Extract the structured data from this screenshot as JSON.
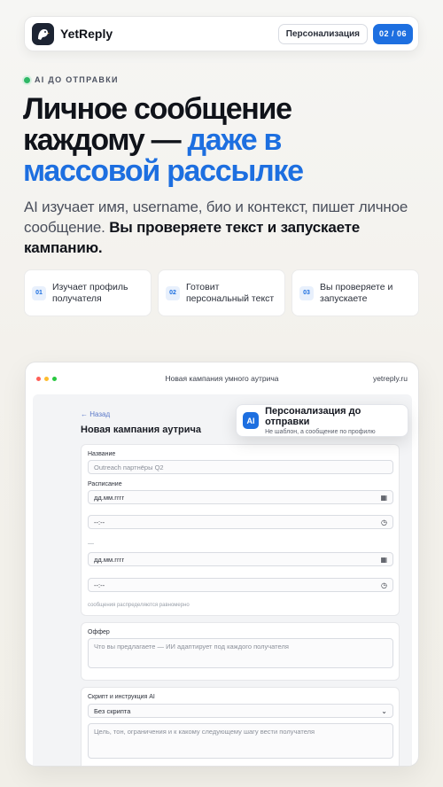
{
  "brand": {
    "name": "YetReply"
  },
  "header": {
    "personalization_button": "Персонализация",
    "page_indicator": "02 / 06"
  },
  "kicker": "AI ДО ОТПРАВКИ",
  "headline": {
    "line1": "Личное сообщение",
    "line2_dark": "каждому — ",
    "line2_accent": "даже в",
    "line3_accent": "массовой рассылке"
  },
  "lead": {
    "plain": "AI изучает имя, username, био и контекст, пишет личное сообщение. ",
    "bold": "Вы проверяете текст и запускаете кампанию."
  },
  "steps": [
    {
      "num": "01",
      "text": "Изучает профиль получателя"
    },
    {
      "num": "02",
      "text": "Готовит персональный текст"
    },
    {
      "num": "03",
      "text": "Вы проверяете и запускаете"
    }
  ],
  "window": {
    "title": "Новая кампания умного аутрича",
    "url": "yetreply.ru",
    "colors": {
      "red": "#ff5f57",
      "yellow": "#febc2e",
      "green": "#28c840"
    }
  },
  "form": {
    "back": "← Назад",
    "title": "Новая кампания аутрича",
    "name_label": "Название",
    "name_placeholder": "Outreach партнёры Q2",
    "schedule_label": "Расписание",
    "date1": "дд.мм.гггг",
    "time1": "--:--",
    "separator": "—",
    "date2": "дд.мм.гггг",
    "time2": "--:--",
    "schedule_hint": "сообщения распределяются равномерно",
    "offer_label": "Оффер",
    "offer_placeholder": "Что вы предлагаете — ИИ адаптирует под каждого получателя",
    "script_label": "Скрипт и инструкция AI",
    "script_select": "Без скрипта",
    "script_placeholder": "Цель, тон, ограничения и к какому следующему шагу вести получателя"
  },
  "popover": {
    "badge": "AI",
    "title": "Персонализация до отправки",
    "subtitle": "Не шаблон, а сообщение по профилю"
  }
}
